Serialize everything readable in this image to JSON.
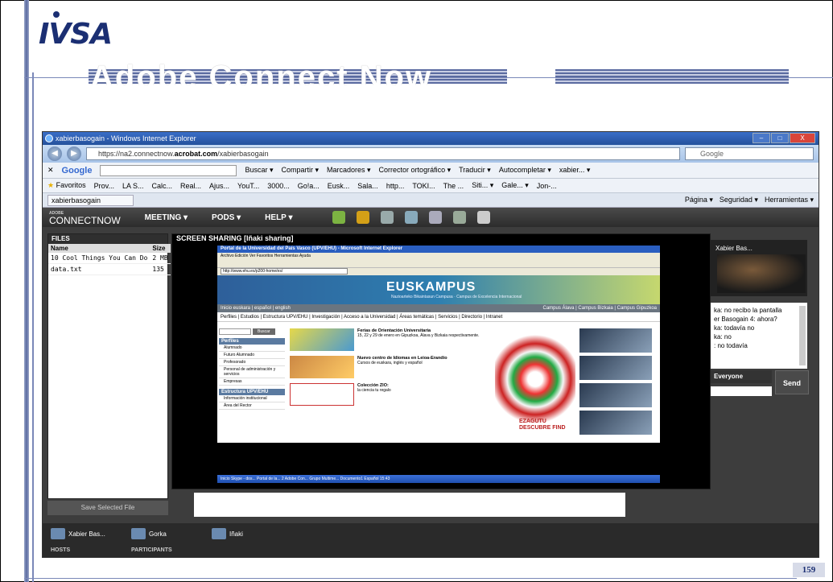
{
  "slide": {
    "logo": "IVSA",
    "title": "Adobe Connect Now",
    "page_number": "159"
  },
  "window": {
    "title": "xabierbasogain - Windows Internet Explorer",
    "controls": [
      "–",
      "□",
      "X"
    ]
  },
  "address_bar": {
    "url_prefix": "https://na2.connectnow.",
    "url_domain": "acrobat.com",
    "url_suffix": "/xabierbasogain",
    "search_placeholder": "Google"
  },
  "google_toolbar": {
    "logo": "Google",
    "items": [
      "Buscar ▾",
      "Compartir ▾",
      "Marcadores ▾",
      "Corrector ortográfico ▾",
      "Traducir ▾",
      "Autocompletar ▾",
      "xabier... ▾"
    ]
  },
  "favorites_bar": {
    "label": "Favoritos",
    "items": [
      "Prov...",
      "LA S...",
      "Calc...",
      "Real...",
      "Ajus...",
      "YouT...",
      "3000...",
      "Go!a...",
      "Eusk...",
      "Sala...",
      "http...",
      "TOKI...",
      "The ...",
      "Siti... ▾",
      "Gale... ▾",
      "Jon-..."
    ]
  },
  "tab_row": {
    "active_tab": "xabierbasogain",
    "tools": [
      "Página ▾",
      "Seguridad ▾",
      "Herramientas ▾"
    ]
  },
  "connect": {
    "brand_small": "ADOBE",
    "brand": "CONNECTNOW",
    "menus": [
      "MEETING ▾",
      "PODS ▾",
      "HELP ▾"
    ],
    "files": {
      "title": "FILES",
      "columns": [
        "Name",
        "Size"
      ],
      "rows": [
        [
          "10 Cool Things You Can Do",
          "2 MB"
        ],
        [
          "data.txt",
          "135"
        ]
      ],
      "save_button": "Save Selected File"
    },
    "screen_share": {
      "title": "SCREEN SHARING   [Iñaki sharing]"
    },
    "video": {
      "name": "Xabier Bas..."
    },
    "chat": {
      "messages": [
        "ka: no recibo la pantalla",
        "er Basogain 4: ahora?",
        "ka: todavía no",
        "ka: no",
        ": no todavía"
      ],
      "recipient": "Everyone",
      "send": "Send"
    },
    "attendees": [
      {
        "name": "Xabier Bas..."
      },
      {
        "name": "Gorka"
      },
      {
        "name": "Iñaki"
      }
    ],
    "labels": {
      "hosts": "HOSTS",
      "participants": "PARTICIPANTS"
    }
  },
  "shared_page": {
    "title": "Portal de la Universidad del País Vasco (UPV/EHU) - Microsoft Internet Explorer",
    "menu": "Archivo  Edición  Ver  Favoritos  Herramientas  Ayuda",
    "address": "http://www.ehu.es/p200-home/es/",
    "banner": "EUSKAMPUS",
    "banner_sub": "Nazioarteko Bikaintasun Campusa · Campus de Excelencia Internacional",
    "nav_left": "Inicio    euskara | español | english",
    "nav_right": "Campus Álava | Campus Bizkaia | Campus Gipuzkoa",
    "links": "Perfiles | Estudios | Estructura UPV/EHU | Investigación | Acceso a la Universidad | Áreas temáticas | Servicios | Directorio | Intranet",
    "search_button": "Buscar",
    "perfiles": {
      "title": "Perfiles",
      "items": [
        "Alumnado",
        "Futuro Alumnado",
        "Profesorado",
        "Personal de administración y servicios",
        "Empresas"
      ]
    },
    "estructura": {
      "title": "Estructura UPV/EHU",
      "items": [
        "Información institucional",
        "Área del Rector"
      ]
    },
    "news": [
      {
        "title": "Ferias de Orientación Universitaria",
        "text": "15, 22 y 29 de enero en Gipuzkoa, Álava y Bizkaia respectivamente."
      },
      {
        "title": "Nuevo centro de Idiomas en Leioa-Erandio",
        "text": "Cursos de euskara, inglés y español"
      },
      {
        "title": "Colección ZIO:",
        "text": "la ciencia tu regalo"
      }
    ],
    "art_text": "EZAGUTU DESCUBRE FIND",
    "taskbar": "Inicio   Skype - dos...   Portal de la...   2 Adobe Con...   Grupo Multime...   Documento1   Español   15:43"
  }
}
